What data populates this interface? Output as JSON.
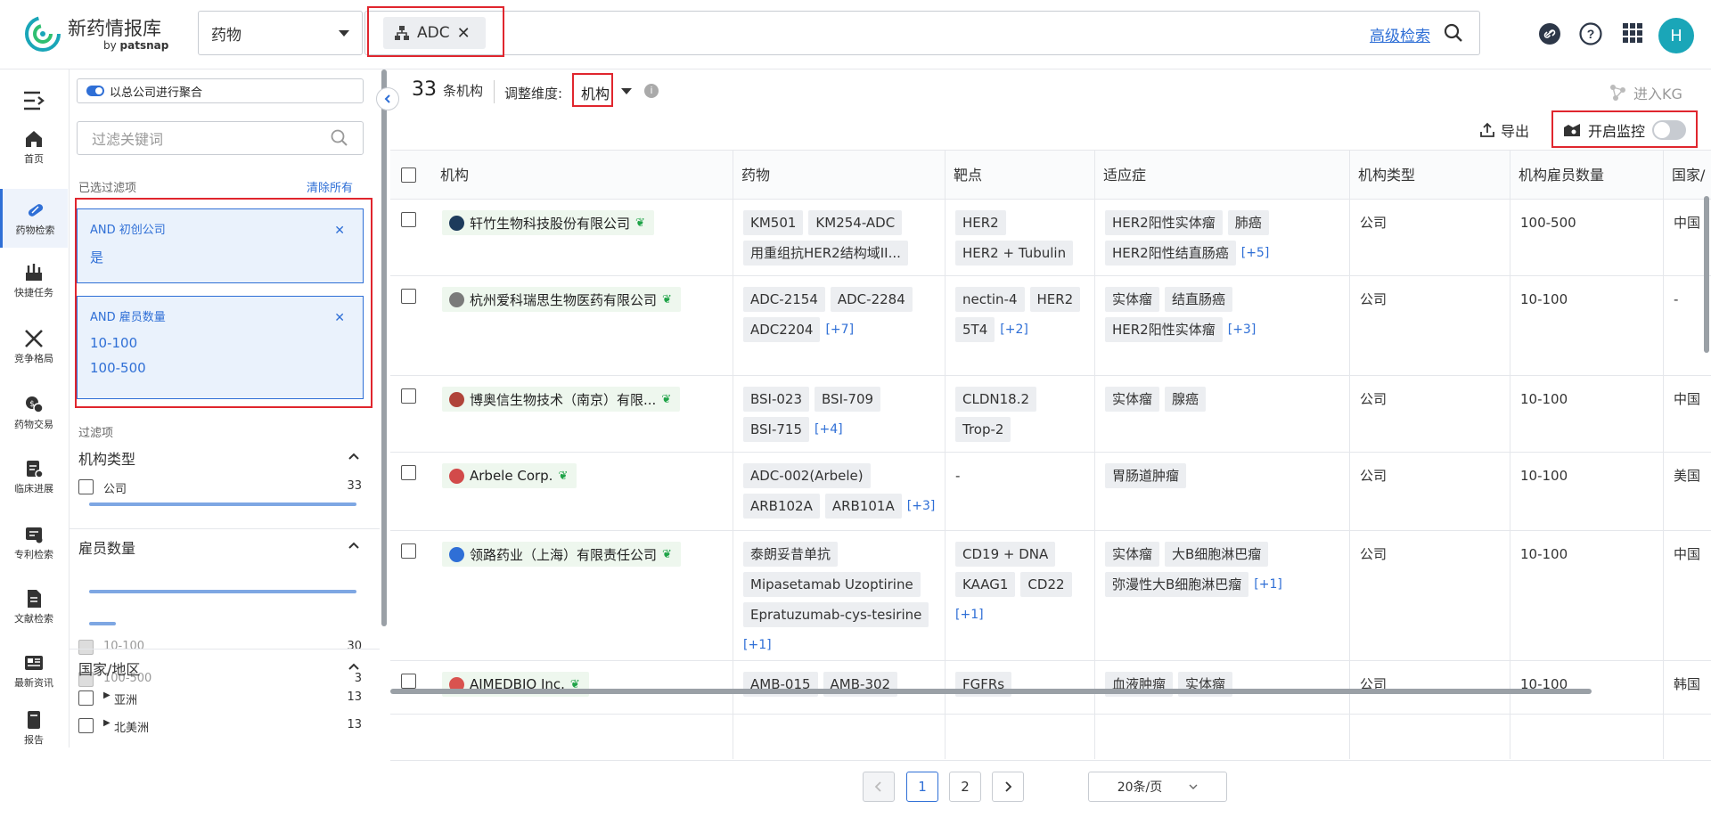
{
  "brand": {
    "title": "新药情报库",
    "sub_prefix": "by ",
    "sub_name": "patsnap"
  },
  "search": {
    "type_value": "药物",
    "chip_label": "ADC",
    "advanced_label": "高级检索"
  },
  "user": {
    "avatar_letter": "H"
  },
  "nav": [
    {
      "label": "首页",
      "icon": "home-icon"
    },
    {
      "label": "药物检索",
      "icon": "pill-icon",
      "active": true
    },
    {
      "label": "快捷任务",
      "icon": "task-icon"
    },
    {
      "label": "竞争格局",
      "icon": "swords-icon"
    },
    {
      "label": "药物交易",
      "icon": "deal-icon"
    },
    {
      "label": "临床进展",
      "icon": "clinical-icon"
    },
    {
      "label": "专利检索",
      "icon": "patent-icon"
    },
    {
      "label": "文献检索",
      "icon": "document-icon"
    },
    {
      "label": "最新资讯",
      "icon": "news-icon"
    },
    {
      "label": "报告",
      "icon": "report-icon"
    }
  ],
  "filter": {
    "aggregate_label": "以总公司进行聚合",
    "keyword_placeholder": "过滤关键词",
    "selected_label": "已选过滤项",
    "clear_all": "清除所有",
    "selected": [
      {
        "title": "AND 初创公司",
        "values": [
          "是"
        ]
      },
      {
        "title": "AND 雇员数量",
        "values": [
          "10-100",
          "100-500"
        ]
      }
    ],
    "section_label": "过滤项",
    "groups": [
      {
        "title": "机构类型",
        "options": [
          {
            "label": "公司",
            "count": "33",
            "fraction": 1.0,
            "disabled": false
          }
        ]
      },
      {
        "title": "雇员数量",
        "options": [
          {
            "label": "10-100",
            "count": "30",
            "fraction": 1.0,
            "disabled": true
          },
          {
            "label": "100-500",
            "count": "3",
            "fraction": 0.1,
            "disabled": true
          }
        ]
      },
      {
        "title": "国家/地区",
        "options": [
          {
            "label": "亚洲",
            "count": "13"
          },
          {
            "label": "北美洲",
            "count": "13"
          }
        ]
      }
    ]
  },
  "results": {
    "count": "33",
    "count_unit": "条机构",
    "adjust_label": "调整维度:",
    "dimension": "机构",
    "enter_kg": "进入KG",
    "export": "导出",
    "monitor": "开启监控"
  },
  "table": {
    "columns": [
      "机构",
      "药物",
      "靶点",
      "适应症",
      "机构类型",
      "机构雇员数量",
      "国家/"
    ],
    "rows": [
      {
        "org": "轩竹生物科技股份有限公司",
        "logo_color": "#1d3b5c",
        "drugs": [
          "KM501",
          "KM254-ADC",
          "用重组抗HER2结构域II..."
        ],
        "drugs_more": "",
        "targets": [
          "HER2",
          "HER2 + Tubulin"
        ],
        "targets_more": "",
        "indications": [
          "HER2阳性实体瘤",
          "肺癌",
          "HER2阳性结直肠癌"
        ],
        "ind_more": "[+5]",
        "type": "公司",
        "employees": "100-500",
        "country": "中国"
      },
      {
        "org": "杭州爱科瑞思生物医药有限公司",
        "logo_color": "#7a7a7a",
        "drugs": [
          "ADC-2154",
          "ADC-2284",
          "ADC2204"
        ],
        "drugs_more": "[+7]",
        "targets": [
          "nectin-4",
          "HER2",
          "5T4"
        ],
        "targets_more": "[+2]",
        "indications": [
          "实体瘤",
          "结直肠癌",
          "HER2阳性实体瘤"
        ],
        "ind_more": "[+3]",
        "type": "公司",
        "employees": "10-100",
        "country": "-"
      },
      {
        "org": "博奥信生物技术（南京）有限...",
        "logo_color": "#b0443a",
        "drugs": [
          "BSI-023",
          "BSI-709",
          "BSI-715"
        ],
        "drugs_more": "[+4]",
        "targets": [
          "CLDN18.2",
          "Trop-2"
        ],
        "targets_more": "",
        "indications": [
          "实体瘤",
          "腺癌"
        ],
        "ind_more": "",
        "type": "公司",
        "employees": "10-100",
        "country": "中国"
      },
      {
        "org": "Arbele Corp.",
        "logo_color": "#d24a4a",
        "drugs": [
          "ADC-002(Arbele)",
          "ARB102A",
          "ARB101A"
        ],
        "drugs_more": "[+3]",
        "targets": [],
        "targets_text": "-",
        "targets_more": "",
        "indications": [
          "胃肠道肿瘤"
        ],
        "ind_more": "",
        "type": "公司",
        "employees": "10-100",
        "country": "美国"
      },
      {
        "org": "领路药业（上海）有限责任公司",
        "logo_color": "#2f6fd6",
        "drugs": [
          "泰朗妥昔单抗",
          "Mipasetamab Uzoptirine",
          "Epratuzumab-cys-tesirine"
        ],
        "drugs_more": "[+1]",
        "targets": [
          "CD19 + DNA",
          "KAAG1",
          "CD22"
        ],
        "targets_more": "[+1]",
        "indications": [
          "实体瘤",
          "大B细胞淋巴瘤",
          "弥漫性大B细胞淋巴瘤"
        ],
        "ind_more": "[+1]",
        "type": "公司",
        "employees": "10-100",
        "country": "中国"
      },
      {
        "org": "AIMEDBIO Inc.",
        "logo_color": "#d9534f",
        "drugs": [
          "AMB-015",
          "AMB-302"
        ],
        "drugs_more": "",
        "targets": [
          "FGFRs"
        ],
        "targets_more": "",
        "indications": [
          "血液肿瘤",
          "实体瘤"
        ],
        "ind_more": "",
        "type": "公司",
        "employees": "10-100",
        "country": "韩国"
      }
    ]
  },
  "pager": {
    "pages": [
      "1",
      "2"
    ],
    "current": "1",
    "page_size": "20条/页"
  }
}
